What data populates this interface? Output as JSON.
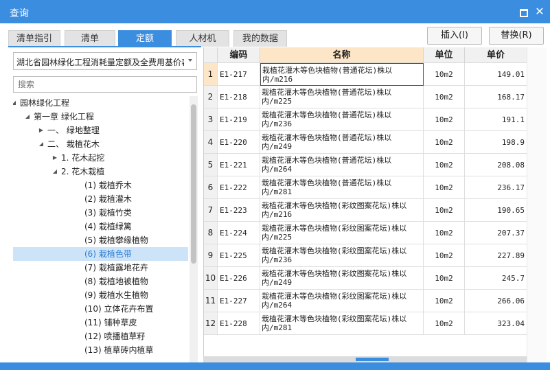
{
  "window": {
    "title": "查询"
  },
  "tabs": [
    "清单指引",
    "清单",
    "定额",
    "人材机",
    "我的数据"
  ],
  "active_tab": 2,
  "buttons": {
    "insert": "插入(I)",
    "replace": "替换(R)"
  },
  "dropdown": {
    "value": "湖北省园林绿化工程消耗量定额及全费用基价表"
  },
  "search": {
    "placeholder": "搜索"
  },
  "tree": [
    {
      "label": "园林绿化工程",
      "level": 0,
      "toggle": "expanded"
    },
    {
      "label": "第一章 绿化工程",
      "level": 1,
      "toggle": "expanded"
    },
    {
      "label": "一、 绿地整理",
      "level": 2,
      "toggle": "collapsed"
    },
    {
      "label": "二、 栽植花木",
      "level": 2,
      "toggle": "expanded"
    },
    {
      "label": "1. 花木起挖",
      "level": 3,
      "toggle": "collapsed"
    },
    {
      "label": "2. 花木栽植",
      "level": 3,
      "toggle": "expanded"
    },
    {
      "label": "(1) 栽植乔木",
      "level": 4,
      "toggle": "none"
    },
    {
      "label": "(2) 栽植灌木",
      "level": 4,
      "toggle": "none"
    },
    {
      "label": "(3) 栽植竹类",
      "level": 4,
      "toggle": "none"
    },
    {
      "label": "(4) 栽植绿篱",
      "level": 4,
      "toggle": "none"
    },
    {
      "label": "(5) 栽植攀缘植物",
      "level": 4,
      "toggle": "none"
    },
    {
      "label": "(6) 栽植色带",
      "level": 4,
      "toggle": "none",
      "selected": true
    },
    {
      "label": "(7) 栽植露地花卉",
      "level": 4,
      "toggle": "none"
    },
    {
      "label": "(8) 栽植地被植物",
      "level": 4,
      "toggle": "none"
    },
    {
      "label": "(9) 栽植水生植物",
      "level": 4,
      "toggle": "none"
    },
    {
      "label": "(10) 立体花卉布置",
      "level": 4,
      "toggle": "none"
    },
    {
      "label": "(11) 铺种草皮",
      "level": 4,
      "toggle": "none"
    },
    {
      "label": "(12) 喷播植草籽",
      "level": 4,
      "toggle": "none"
    },
    {
      "label": "(13) 植草砖内植草",
      "level": 4,
      "toggle": "none"
    }
  ],
  "table": {
    "headers": {
      "code": "编码",
      "name": "名称",
      "unit": "单位",
      "price": "单价"
    },
    "selected_row": 0,
    "rows": [
      {
        "no": "1",
        "code": "E1-217",
        "name": "栽植花灌木等色块植物(普通花坛)株以内/m216",
        "unit": "10m2",
        "price": "149.01"
      },
      {
        "no": "2",
        "code": "E1-218",
        "name": "栽植花灌木等色块植物(普通花坛)株以内/m225",
        "unit": "10m2",
        "price": "168.17"
      },
      {
        "no": "3",
        "code": "E1-219",
        "name": "栽植花灌木等色块植物(普通花坛)株以内/m236",
        "unit": "10m2",
        "price": "191.1"
      },
      {
        "no": "4",
        "code": "E1-220",
        "name": "栽植花灌木等色块植物(普通花坛)株以内/m249",
        "unit": "10m2",
        "price": "198.9"
      },
      {
        "no": "5",
        "code": "E1-221",
        "name": "栽植花灌木等色块植物(普通花坛)株以内/m264",
        "unit": "10m2",
        "price": "208.08"
      },
      {
        "no": "6",
        "code": "E1-222",
        "name": "栽植花灌木等色块植物(普通花坛)株以内/m281",
        "unit": "10m2",
        "price": "236.17"
      },
      {
        "no": "7",
        "code": "E1-223",
        "name": "栽植花灌木等色块植物(彩纹图案花坛)株以内/m216",
        "unit": "10m2",
        "price": "190.65"
      },
      {
        "no": "8",
        "code": "E1-224",
        "name": "栽植花灌木等色块植物(彩纹图案花坛)株以内/m225",
        "unit": "10m2",
        "price": "207.37"
      },
      {
        "no": "9",
        "code": "E1-225",
        "name": "栽植花灌木等色块植物(彩纹图案花坛)株以内/m236",
        "unit": "10m2",
        "price": "227.89"
      },
      {
        "no": "10",
        "code": "E1-226",
        "name": "栽植花灌木等色块植物(彩纹图案花坛)株以内/m249",
        "unit": "10m2",
        "price": "245.7"
      },
      {
        "no": "11",
        "code": "E1-227",
        "name": "栽植花灌木等色块植物(彩纹图案花坛)株以内/m264",
        "unit": "10m2",
        "price": "266.06"
      },
      {
        "no": "12",
        "code": "E1-228",
        "name": "栽植花灌木等色块植物(彩纹图案花坛)株以内/m281",
        "unit": "10m2",
        "price": "323.04"
      }
    ]
  },
  "colors": {
    "accent": "#3b8de0",
    "selected_header": "#fde6c8",
    "tree_selected": "#cde4f8"
  },
  "icons": {
    "maximize": "maximize-icon",
    "close": "close-icon",
    "dropdown": "chevron-down-icon",
    "expanded": "triangle-down-icon",
    "collapsed": "triangle-right-icon"
  }
}
